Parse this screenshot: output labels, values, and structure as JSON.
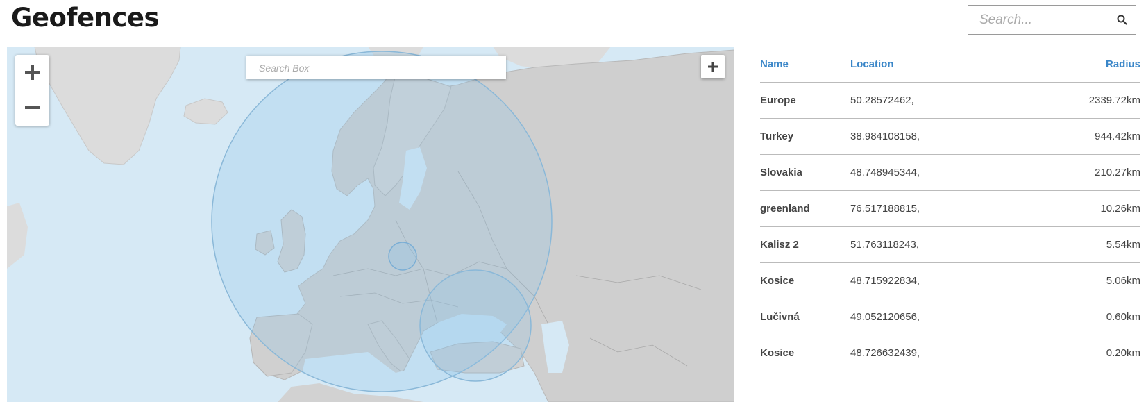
{
  "header": {
    "title": "Geofences"
  },
  "search": {
    "placeholder": "Search..."
  },
  "map": {
    "search_placeholder": "Search Box",
    "zoom_in_icon": "plus-icon",
    "zoom_out_icon": "minus-icon",
    "draw_icon": "plus-icon"
  },
  "table": {
    "headers": {
      "name": "Name",
      "location": "Location",
      "radius": "Radius"
    },
    "rows": [
      {
        "name": "Europe",
        "location": "50.28572462,",
        "radius": "2339.72km"
      },
      {
        "name": "Turkey",
        "location": "38.984108158,",
        "radius": "944.42km"
      },
      {
        "name": "Slovakia",
        "location": "48.748945344,",
        "radius": "210.27km"
      },
      {
        "name": "greenland",
        "location": "76.517188815,",
        "radius": "10.26km"
      },
      {
        "name": "Kalisz 2",
        "location": "51.763118243,",
        "radius": "5.54km"
      },
      {
        "name": "Kosice",
        "location": "48.715922834,",
        "radius": "5.06km"
      },
      {
        "name": "Lučivná",
        "location": "49.052120656,",
        "radius": "0.60km"
      },
      {
        "name": "Kosice",
        "location": "48.726632439,",
        "radius": "0.20km"
      }
    ]
  },
  "colors": {
    "accent": "#3a86c8",
    "water": "#d6e9f5",
    "land": "#dadada",
    "fence": "#8fc4e8"
  }
}
